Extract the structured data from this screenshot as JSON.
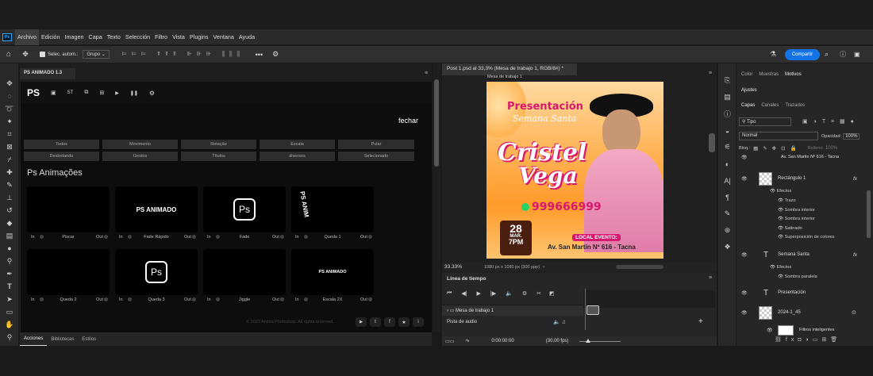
{
  "app": {
    "logo": "Ps"
  },
  "menu": [
    "Archivo",
    "Edición",
    "Imagen",
    "Capa",
    "Texto",
    "Selección",
    "Filtro",
    "Vista",
    "Plugins",
    "Ventana",
    "Ayuda"
  ],
  "options": {
    "auto_select_label": "Selec. autom.:",
    "auto_select_value": "Grupo",
    "share_button": "Compartir"
  },
  "plugin": {
    "tab_title": "PS ANIMADO 1.3",
    "logo": "PS",
    "nav_st": "ST",
    "close_link": "fechar",
    "categories_row1": [
      "Todos",
      "Movimento",
      "Rotação",
      "Escala",
      "Pular"
    ],
    "categories_row2": [
      "Desbotando",
      "Gestos",
      "Títulos",
      "diversos",
      "Selecionado"
    ],
    "section_title": "Ps Animações",
    "in_label": "In",
    "out_label": "Out",
    "cards": [
      {
        "name": "Piscar",
        "art": ""
      },
      {
        "name": "Fade Rápido",
        "art": "PS ANIMADO"
      },
      {
        "name": "Fade",
        "art": "Ps"
      },
      {
        "name": "Queda 1",
        "art": "PS ANIM"
      },
      {
        "name": "Queda 2",
        "art": ""
      },
      {
        "name": "Queda 3",
        "art": "Ps"
      },
      {
        "name": "Jiggle",
        "art": ""
      },
      {
        "name": "Escala 2X",
        "art": "PS ANIMADO"
      }
    ],
    "footer": "© 2023 Anima Photoshop. All rights reserved."
  },
  "bottom_tabs": [
    "Acciones",
    "Bibliotecas",
    "Estilos"
  ],
  "document": {
    "tab_title": "Post 1.psd al 33,3% (Mesa de trabajo 1, RGB/8#) *",
    "artboard_label": "Mesa de trabajo 1",
    "zoom": "33.33%",
    "doc_info": "1080 px x 1080 px (300 ppp)"
  },
  "poster": {
    "line1": "Presentación",
    "line2": "Semana Santa",
    "name1": "Cristel",
    "name2": "Vega",
    "phone": "999666999",
    "date_day": "28",
    "date_month": "MAR.",
    "date_time": "7PM",
    "event_label": "LOCAL EVENTO:",
    "event_address": "Av. San Martin Nº 616 - Tacna"
  },
  "timeline": {
    "title": "Línea de tiempo",
    "track1": "Mesa de trabajo 1",
    "track2": "Pista de audio",
    "time": "0:00:00:00",
    "fps": "(30,00 fps)"
  },
  "right_panel": {
    "top_tabs": [
      "Color",
      "Muestras",
      "Motivos"
    ],
    "adjust_tab": "Ajustes",
    "layer_tabs": [
      "Capas",
      "Canales",
      "Trazados"
    ],
    "filter_kind": "Tipo",
    "blend_mode": "Normal",
    "opacity_label": "Opacidad:",
    "opacity_value": "100%",
    "lock_label": "Bloq.:",
    "fill_label": "Relleno:",
    "fill_value": "100%",
    "partial_layer": "Av. San Martin Nº 616 - Tacna",
    "layer_rect": "Rectángulo 1",
    "effects_label": "Efectos",
    "rect_effects": [
      "Trazo",
      "Sombra interior",
      "Sombra interior",
      "Satinado",
      "Superposición de colores"
    ],
    "layer_semana": "Semana Santa",
    "semana_effects": [
      "Sombra paralela"
    ],
    "layer_presentacion": "Presentación",
    "layer_img": "2024-1_45",
    "smart_filters": "Filtros inteligentes"
  },
  "colors": {
    "accent": "#1473e6",
    "poster_pink": "#d6186f",
    "poster_orange": "#ff9b2a"
  }
}
